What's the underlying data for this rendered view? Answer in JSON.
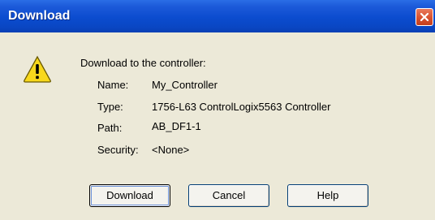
{
  "window": {
    "title": "Download",
    "close_icon": "close-x-icon"
  },
  "dialog": {
    "icon": "warning-icon",
    "message": "Download to the controller:",
    "fields": [
      {
        "label": "Name:",
        "value": "My_Controller"
      },
      {
        "label": "Type:",
        "value": "1756-L63 ControlLogix5563 Controller"
      },
      {
        "label": "Path:",
        "value": "AB_DF1-1"
      },
      {
        "label": "Security:",
        "value": "<None>"
      }
    ]
  },
  "buttons": {
    "download": "Download",
    "cancel": "Cancel",
    "help": "Help"
  },
  "colors": {
    "titlebar": "#0b4ccf",
    "client_bg": "#ece9d8",
    "close_button": "#d8512f",
    "warning_yellow": "#f8d81c"
  }
}
